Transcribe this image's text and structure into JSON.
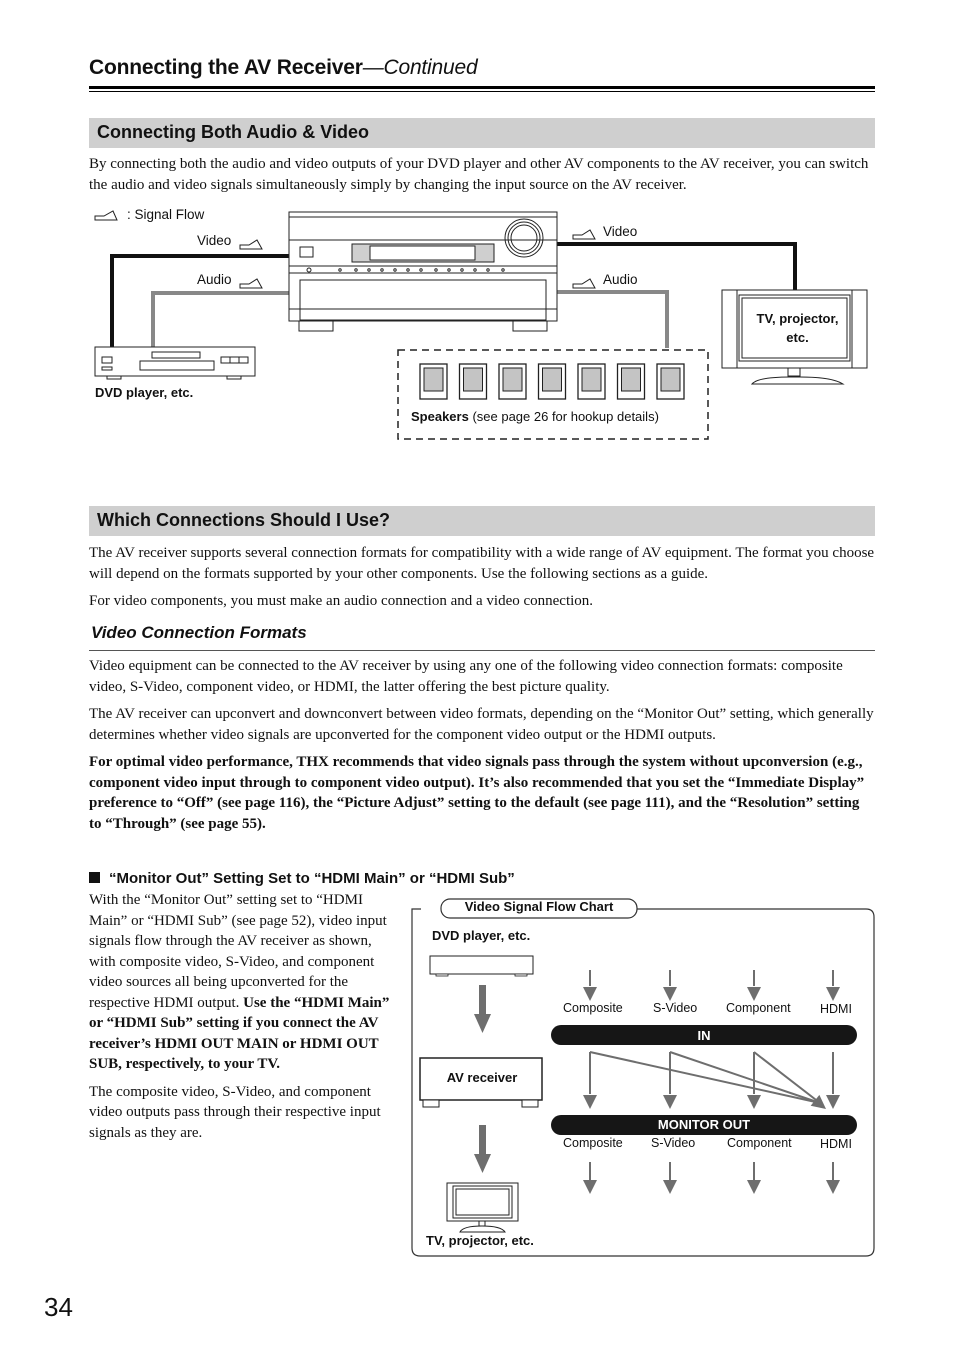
{
  "header": {
    "title": "Connecting the AV Receiver",
    "continued": "—Continued"
  },
  "section1": {
    "title": "Connecting Both Audio & Video",
    "paragraph": "By connecting both the audio and video outputs of your DVD player and other AV components to the AV receiver, you can switch the audio and video signals simultaneously simply by changing the input source on the AV receiver.",
    "diagram": {
      "legend_label": ": Signal Flow",
      "video_in_label": "Video",
      "audio_in_label": "Audio",
      "video_out_label": "Video",
      "audio_out_label": "Audio",
      "dvd_label": "DVD player, etc.",
      "tv_label_line1": "TV, projector,",
      "tv_label_line2": "etc.",
      "speakers_bold": "Speakers",
      "speakers_note": " (see page 26 for hookup details)",
      "speaker_count": 7,
      "video_line_color": "#111111",
      "audio_line_color": "#808080"
    }
  },
  "section2": {
    "title": "Which Connections Should I Use?",
    "paragraph1": "The AV receiver supports several connection formats for compatibility with a wide range of AV equipment. The format you choose will depend on the formats supported by your other components. Use the following sections as a guide.",
    "paragraph2": "For video components, you must make an audio connection and a video connection.",
    "subheading": "Video Connection Formats",
    "paragraph3": "Video equipment can be connected to the AV receiver by using any one of the following video connection formats: composite video, S-Video, component video, or HDMI, the latter offering the best picture quality.",
    "paragraph4": "The AV receiver can upconvert and downconvert between video formats, depending on the “Monitor Out” setting, which generally determines whether video signals are upconverted for the component video output or the HDMI outputs.",
    "paragraph5_bold": "For optimal video performance, THX recommends that video signals pass through the system without upconversion (e.g., component video input through to component video output). It’s also recommended that you set the “Immediate Display” preference to “Off” (see page 116), the “Picture Adjust” setting to the default (see page 111), and the “Resolution” setting to “Through” (see page 55)."
  },
  "monitor_out": {
    "heading": "“Monitor Out” Setting Set to “HDMI Main” or “HDMI Sub”",
    "para1_normal": "With the “Monitor Out” setting set to “HDMI Main” or “HDMI Sub” (see page 52), video input signals flow through the AV receiver as shown, with composite video, S-Video, and component video sources all being upconverted for the respective HDMI output. ",
    "para1_bold": "Use the “HDMI Main” or “HDMI Sub” setting if you connect the AV receiver’s HDMI OUT MAIN or HDMI OUT SUB, respectively, to your TV.",
    "para2": "The composite video, S-Video, and component video outputs pass through their respective input signals as they are."
  },
  "flow_chart": {
    "title": "Video Signal Flow Chart",
    "source_label": "DVD player, etc.",
    "receiver_label": "AV receiver",
    "display_label": "TV, projector, etc.",
    "in_bar": "IN",
    "out_bar": "MONITOR OUT",
    "inputs": [
      "Composite",
      "S-Video",
      "Component",
      "HDMI"
    ],
    "outputs": [
      "Composite",
      "S-Video",
      "Component",
      "HDMI"
    ]
  },
  "page_number": "34"
}
